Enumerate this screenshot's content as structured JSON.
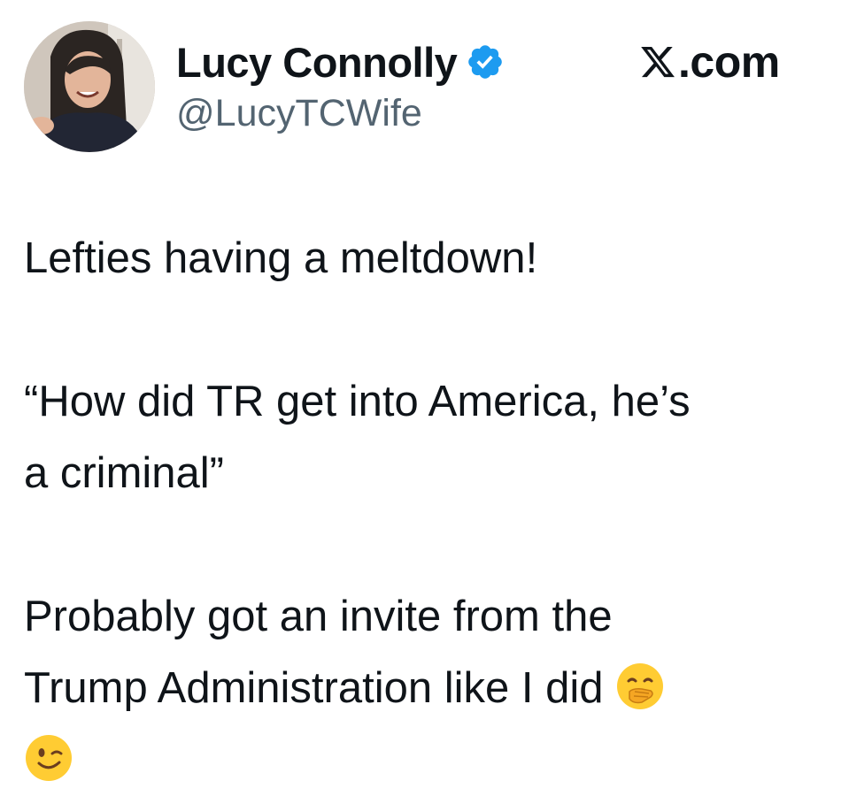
{
  "author": {
    "display_name": "Lucy Connolly",
    "handle": "@LucyTCWife",
    "verified": true,
    "verified_badge_icon": "verified-badge-icon",
    "avatar_icon": "profile-photo"
  },
  "site": {
    "label": ".com",
    "logo_icon": "x-logo-icon"
  },
  "tweet": {
    "paragraph1": "Lefties having a meltdown!",
    "paragraph2_line1": "“How did TR get into America, he’s",
    "paragraph2_line2": "a criminal”",
    "paragraph3_line1": "Probably got an invite from the",
    "paragraph3_line2": "Trump Administration like I did",
    "emojis": [
      "hand-over-mouth-emoji",
      "winking-face-emoji"
    ]
  },
  "colors": {
    "text": "#0f1419",
    "handle": "#536471",
    "verified_blue": "#1d9bf0",
    "emoji_yellow": "#ffcc33"
  }
}
